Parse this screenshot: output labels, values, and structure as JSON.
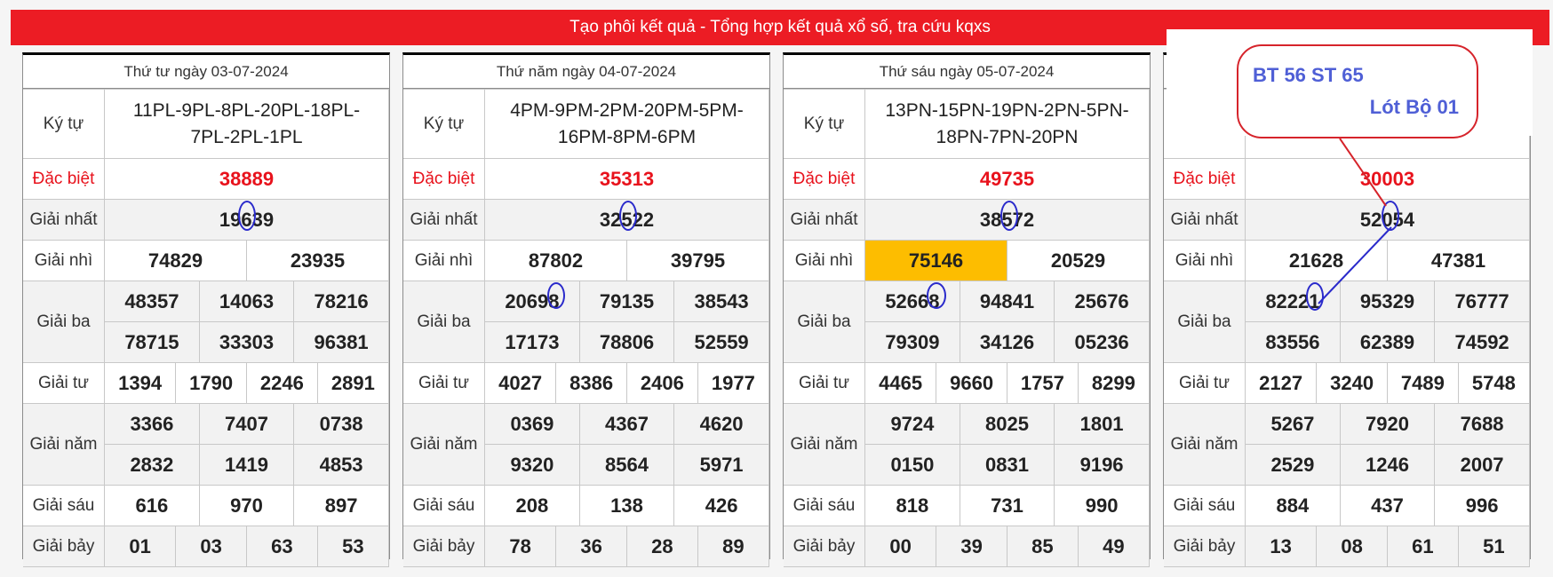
{
  "banner": "Tạo phôi kết quả - Tổng hợp kết quả xổ số, tra cứu kqxs",
  "labels": {
    "ky_tu": "Ký tự",
    "dac_biet": "Đặc biệt",
    "giai_nhat": "Giải nhất",
    "giai_nhi": "Giải nhì",
    "giai_ba": "Giải ba",
    "giai_tu": "Giải tư",
    "giai_nam": "Giải năm",
    "giai_sau": "Giải sáu",
    "giai_bay": "Giải bảy"
  },
  "note": {
    "line1": "BT 56 ST 65",
    "line2": "Lót Bộ 01"
  },
  "colors": {
    "banner": "#ec1c24",
    "special": "#e8121c",
    "highlight": "#fdbd00",
    "ring": "#2a2acb",
    "note_border": "#d6242b",
    "note_text": "#4f5fd6"
  },
  "panels": [
    {
      "date": "Thứ tư ngày 03-07-2024",
      "ky_tu_1": "11PL-9PL-8PL-20PL-18PL-",
      "ky_tu_2": "7PL-2PL-1PL",
      "dac_biet": "38889",
      "giai_nhat": "19639",
      "giai_nhi": [
        "74829",
        "23935"
      ],
      "giai_ba": [
        "48357",
        "14063",
        "78216",
        "78715",
        "33303",
        "96381"
      ],
      "giai_tu": [
        "1394",
        "1790",
        "2246",
        "2891"
      ],
      "giai_nam": [
        "3366",
        "7407",
        "0738",
        "2832",
        "1419",
        "4853"
      ],
      "giai_sau": [
        "616",
        "970",
        "897"
      ],
      "giai_bay": [
        "01",
        "03",
        "63",
        "53"
      ]
    },
    {
      "date": "Thứ năm ngày 04-07-2024",
      "ky_tu_1": "4PM-9PM-2PM-20PM-5PM-",
      "ky_tu_2": "16PM-8PM-6PM",
      "dac_biet": "35313",
      "giai_nhat": "32522",
      "giai_nhi": [
        "87802",
        "39795"
      ],
      "giai_ba": [
        "20698",
        "79135",
        "38543",
        "17173",
        "78806",
        "52559"
      ],
      "giai_tu": [
        "4027",
        "8386",
        "2406",
        "1977"
      ],
      "giai_nam": [
        "0369",
        "4367",
        "4620",
        "9320",
        "8564",
        "5971"
      ],
      "giai_sau": [
        "208",
        "138",
        "426"
      ],
      "giai_bay": [
        "78",
        "36",
        "28",
        "89"
      ]
    },
    {
      "date": "Thứ sáu ngày 05-07-2024",
      "ky_tu_1": "13PN-15PN-19PN-2PN-5PN-",
      "ky_tu_2": "18PN-7PN-20PN",
      "dac_biet": "49735",
      "giai_nhat": "38572",
      "giai_nhi": [
        "75146",
        "20529"
      ],
      "giai_ba": [
        "52668",
        "94841",
        "25676",
        "79309",
        "34126",
        "05236"
      ],
      "giai_tu": [
        "4465",
        "9660",
        "1757",
        "8299"
      ],
      "giai_nam": [
        "9724",
        "8025",
        "1801",
        "0150",
        "0831",
        "9196"
      ],
      "giai_sau": [
        "818",
        "731",
        "990"
      ],
      "giai_bay": [
        "00",
        "39",
        "85",
        "49"
      ]
    },
    {
      "date": "",
      "ky_tu_1": "",
      "ky_tu_2": "",
      "dac_biet": "30003",
      "giai_nhat": "52054",
      "giai_nhi": [
        "21628",
        "47381"
      ],
      "giai_ba": [
        "82221",
        "95329",
        "76777",
        "83556",
        "62389",
        "74592"
      ],
      "giai_tu": [
        "2127",
        "3240",
        "7489",
        "5748"
      ],
      "giai_nam": [
        "5267",
        "7920",
        "7688",
        "2529",
        "1246",
        "2007"
      ],
      "giai_sau": [
        "884",
        "437",
        "996"
      ],
      "giai_bay": [
        "13",
        "08",
        "61",
        "51"
      ]
    }
  ]
}
